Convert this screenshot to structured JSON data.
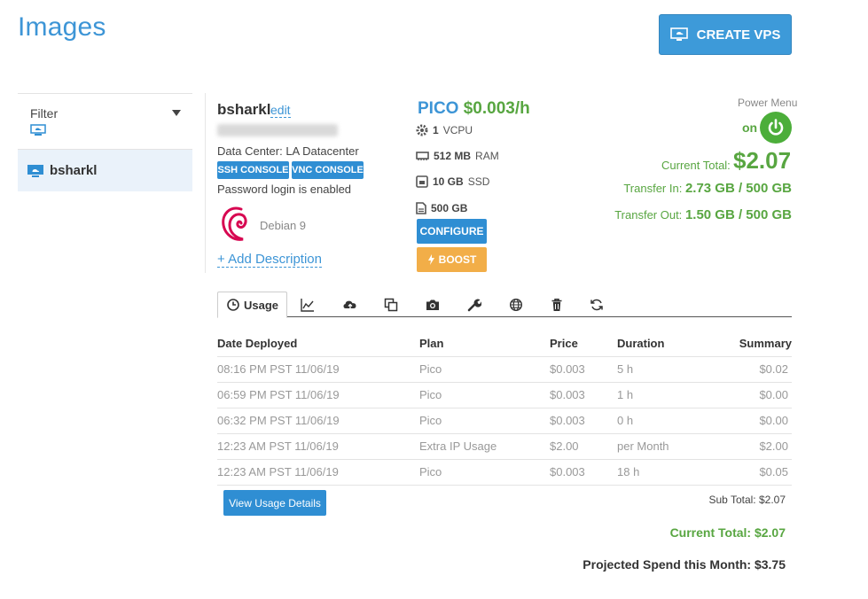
{
  "page": {
    "title": "Images",
    "create_button_label": "CREATE VPS"
  },
  "sidebar": {
    "filter_label": "Filter",
    "items": [
      {
        "label": "bsharkl"
      }
    ]
  },
  "server": {
    "name": "bsharkl",
    "edit_label": "edit",
    "data_center": "Data Center: LA Datacenter",
    "ssh_console_label": "SSH CONSOLE",
    "vnc_console_label": "VNC CONSOLE",
    "password_status": "Password login is enabled",
    "os_name": "Debian 9",
    "add_description_label": "+ Add Description"
  },
  "plan": {
    "name": "PICO",
    "price": "$0.003/h",
    "vcpu": {
      "value": "1",
      "unit": "VCPU"
    },
    "ram": {
      "value": "512 MB",
      "unit": "RAM"
    },
    "ssd": {
      "value": "10 GB",
      "unit": "SSD"
    },
    "transfer": {
      "value": "500 GB",
      "unit": ""
    },
    "configure_label": "CONFIGURE",
    "boost_label": "BOOST"
  },
  "status": {
    "power_menu_label": "Power Menu",
    "power_state": "on",
    "current_total_label": "Current Total:",
    "current_total_value": "$2.07",
    "transfer_in_label": "Transfer In:",
    "transfer_in_value": "2.73 GB / 500 GB",
    "transfer_out_label": "Transfer Out:",
    "transfer_out_value": "1.50 GB / 500 GB"
  },
  "tabs": {
    "active_label": "Usage",
    "icons": [
      "clock-icon",
      "chart-icon",
      "cloud-upload-icon",
      "copy-icon",
      "camera-icon",
      "wrench-icon",
      "globe-icon",
      "trash-icon",
      "refresh-icon"
    ]
  },
  "usage_table": {
    "columns": [
      "Date Deployed",
      "Plan",
      "Price",
      "Duration",
      "Summary"
    ],
    "rows": [
      [
        "08:16 PM PST 11/06/19",
        "Pico",
        "$0.003",
        "5 h",
        "$0.02"
      ],
      [
        "06:59 PM PST 11/06/19",
        "Pico",
        "$0.003",
        "1 h",
        "$0.00"
      ],
      [
        "06:32 PM PST 11/06/19",
        "Pico",
        "$0.003",
        "0 h",
        "$0.00"
      ],
      [
        "12:23 AM PST 11/06/19",
        "Extra IP Usage",
        "$2.00",
        "per Month",
        "$2.00"
      ],
      [
        "12:23 AM PST 11/06/19",
        "Pico",
        "$0.003",
        "18 h",
        "$0.05"
      ]
    ]
  },
  "totals": {
    "view_usage_label": "View Usage Details",
    "sub_total": "Sub Total: $2.07",
    "current_total": "Current Total: $2.07",
    "projected": "Projected Spend this Month: $3.75"
  },
  "colors": {
    "brand_blue": "#3d95d6",
    "button_blue": "#2f8ed3",
    "success_green": "#58a641",
    "boost_orange": "#f2ae48",
    "sidebar_selected": "#eaf2fa"
  }
}
